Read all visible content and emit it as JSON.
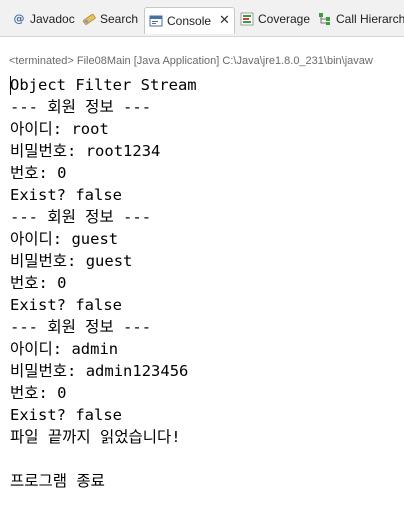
{
  "tabs": [
    {
      "label": "Javadoc",
      "icon": "javadoc-icon"
    },
    {
      "label": "Search",
      "icon": "search-icon"
    },
    {
      "label": "Console",
      "icon": "console-icon",
      "active": true
    },
    {
      "label": "Coverage",
      "icon": "coverage-icon"
    },
    {
      "label": "Call Hierarch",
      "icon": "call-hierarchy-icon"
    }
  ],
  "console": {
    "status": "<terminated> File08Main [Java Application] C:\\Java\\jre1.8.0_231\\bin\\javaw",
    "lines": [
      "Object Filter Stream",
      "--- 회원 정보 ---",
      "아이디: root",
      "비밀번호: root1234",
      "번호: 0",
      "Exist? false",
      "--- 회원 정보 ---",
      "아이디: guest",
      "비밀번호: guest",
      "번호: 0",
      "Exist? false",
      "--- 회원 정보 ---",
      "아이디: admin",
      "비밀번호: admin123456",
      "번호: 0",
      "Exist? false",
      "파일 끝까지 읽었습니다!",
      "",
      "프로그램 종료"
    ]
  },
  "colors": {
    "tabbar_bg": "#f1f1f1",
    "console_text": "#000000",
    "status_text": "#6a6a6a"
  }
}
